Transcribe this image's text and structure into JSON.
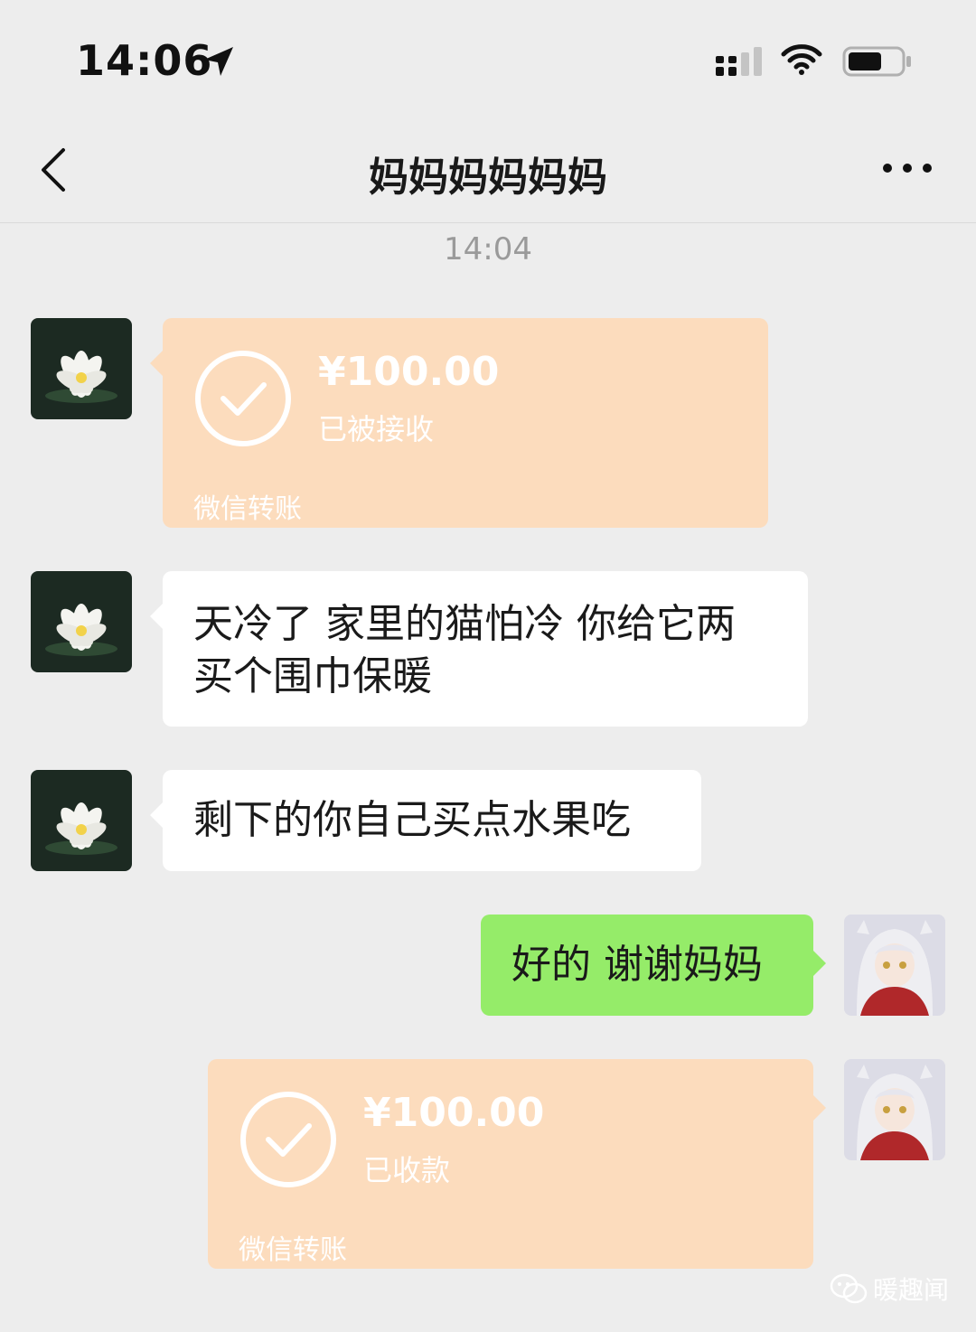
{
  "status_bar": {
    "time": "14:06",
    "icons": [
      "location-arrow-icon",
      "cellular-signal-icon",
      "wifi-icon",
      "battery-icon"
    ]
  },
  "nav": {
    "title": "妈妈妈妈妈妈",
    "back_icon": "chevron-left-icon",
    "more_icon": "more-dots-icon"
  },
  "chat": {
    "timestamp": "14:04",
    "messages": [
      {
        "type": "transfer",
        "from": "mom",
        "amount": "¥100.00",
        "status": "已被接收",
        "footer": "微信转账"
      },
      {
        "type": "text",
        "from": "mom",
        "lines": [
          "天冷了 家里的猫怕冷 你给它两",
          "买个围巾保暖"
        ]
      },
      {
        "type": "text",
        "from": "mom",
        "text": "剩下的你自己买点水果吃"
      },
      {
        "type": "text",
        "from": "me",
        "text": "好的 谢谢妈妈"
      },
      {
        "type": "transfer",
        "from": "me",
        "amount": "¥100.00",
        "status": "已收款",
        "footer": "微信转账"
      }
    ]
  },
  "watermark": {
    "text": "暖趣闻"
  },
  "colors": {
    "background": "#ededed",
    "bubble_white": "#ffffff",
    "bubble_green": "#95ec69",
    "transfer_card": "#fcdcbd"
  }
}
